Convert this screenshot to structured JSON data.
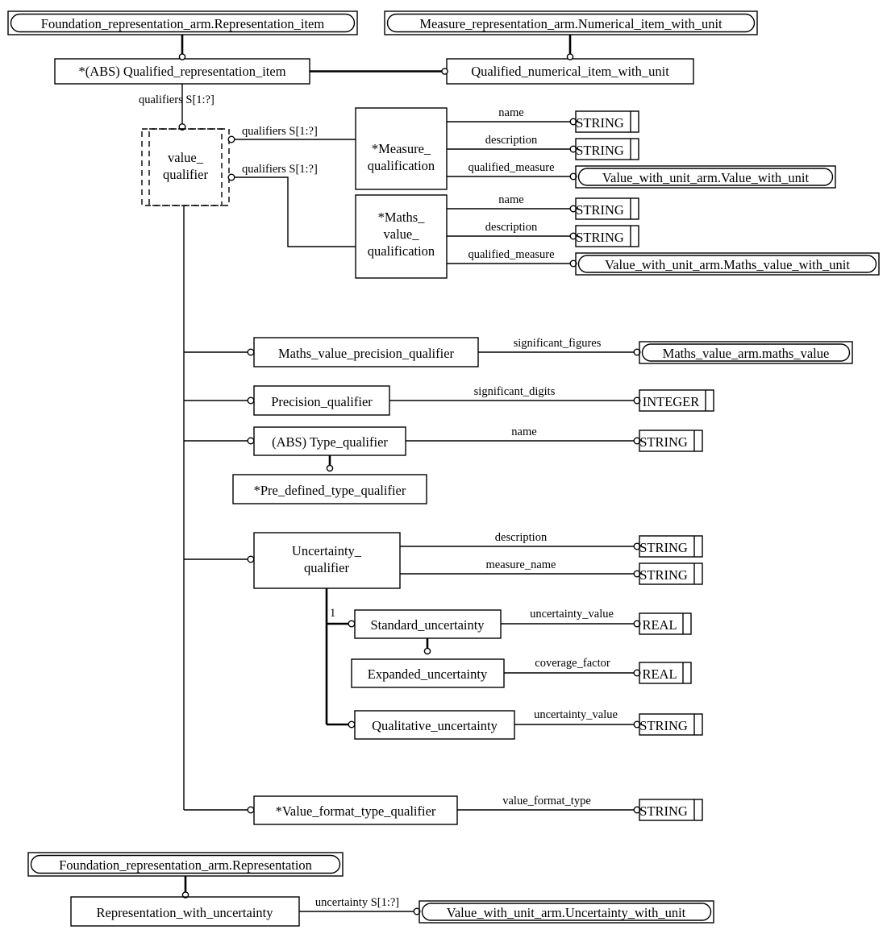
{
  "diagram": {
    "type": "EXPRESS-G entity-level diagram",
    "entities": {
      "foundation_representation_item": "Foundation_representation_arm.Representation_item",
      "measure_numerical_item": "Measure_representation_arm.Numerical_item_with_unit",
      "qualified_representation_item": "*(ABS) Qualified_representation_item",
      "qualified_numerical_item": "Qualified_numerical_item_with_unit",
      "value_qualifier": "value_\nqualifier",
      "value_qualifier_line1": "value_",
      "value_qualifier_line2": "qualifier",
      "measure_qualification_line1": "*Measure_",
      "measure_qualification_line2": "qualification",
      "maths_value_qualification_line1": "*Maths_",
      "maths_value_qualification_line2": "value_",
      "maths_value_qualification_line3": "qualification",
      "maths_value_precision_qualifier": "Maths_value_precision_qualifier",
      "precision_qualifier": "Precision_qualifier",
      "type_qualifier": "(ABS) Type_qualifier",
      "pre_defined_type_qualifier": "*Pre_defined_type_qualifier",
      "uncertainty_qualifier_line1": "Uncertainty_",
      "uncertainty_qualifier_line2": "qualifier",
      "standard_uncertainty": "Standard_uncertainty",
      "expanded_uncertainty": "Expanded_uncertainty",
      "qualitative_uncertainty": "Qualitative_uncertainty",
      "value_format_type_qualifier": "*Value_format_type_qualifier",
      "foundation_representation": "Foundation_representation_arm.Representation",
      "representation_with_uncertainty": "Representation_with_uncertainty",
      "value_with_unit": "Value_with_unit_arm.Value_with_unit",
      "maths_value_with_unit": "Value_with_unit_arm.Maths_value_with_unit",
      "maths_value_arm_maths_value": "Maths_value_arm.maths_value",
      "uncertainty_with_unit": "Value_with_unit_arm.Uncertainty_with_unit"
    },
    "simple_types": {
      "string_measure_name": "STRING",
      "string_measure_description": "STRING",
      "string_maths_name": "STRING",
      "string_maths_description": "STRING",
      "integer_significant_digits": "INTEGER",
      "string_type_name": "STRING",
      "string_unc_description": "STRING",
      "string_unc_measure_name": "STRING",
      "real_standard_uncertainty": "REAL",
      "real_coverage_factor": "REAL",
      "string_qualitative_uncertainty": "STRING",
      "string_value_format_type": "STRING"
    },
    "attributes": {
      "qualifiers_root": "qualifiers S[1:?]",
      "qualifiers_measure": "qualifiers S[1:?]",
      "qualifiers_maths": "qualifiers S[1:?]",
      "name_measure": "name",
      "description_measure": "description",
      "qualified_measure_measure": "qualified_measure",
      "name_maths": "name",
      "description_maths": "description",
      "qualified_measure_maths": "qualified_measure",
      "significant_figures": "significant_figures",
      "significant_digits": "significant_digits",
      "name_type": "name",
      "description_unc": "description",
      "measure_name_unc": "measure_name",
      "uncertainty_value_standard": "uncertainty_value",
      "coverage_factor": "coverage_factor",
      "uncertainty_value_qualitative": "uncertainty_value",
      "value_format_type": "value_format_type",
      "uncertainty_rep": "uncertainty S[1:?]"
    },
    "cardinalities": {
      "uncertainty_subtype_one": "1"
    },
    "colors": {
      "stroke": "#000000",
      "background": "#ffffff"
    }
  }
}
